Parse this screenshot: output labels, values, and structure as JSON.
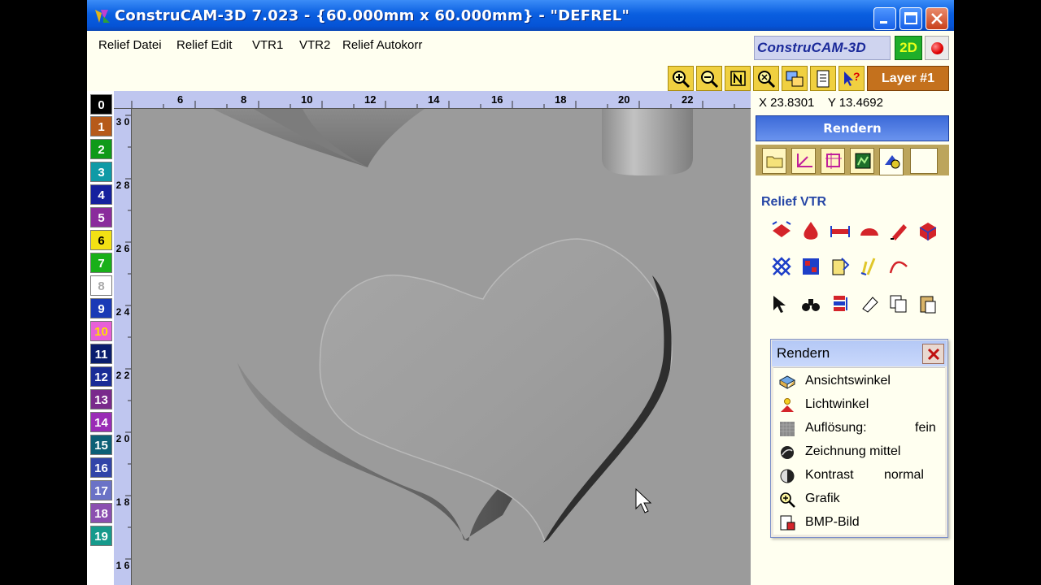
{
  "window": {
    "title": "ConstruCAM-3D 7.023 - {60.000mm x 60.000mm} - \"DEFREL\""
  },
  "menu": [
    {
      "label": "Relief Datei"
    },
    {
      "label": "Relief Edit"
    },
    {
      "label": "VTR1"
    },
    {
      "label": "VTR2"
    },
    {
      "label": "Relief Autokorr"
    }
  ],
  "brand": {
    "logo_text": "ConstruCAM-3D",
    "mode_label": "2D"
  },
  "toolbar": {
    "layer_label": "Layer #1",
    "icons": [
      "zoom-in-icon",
      "zoom-out-icon",
      "normal-view-icon",
      "zoom-fit-icon",
      "view-swap-icon",
      "document-icon",
      "help-pointer-icon"
    ]
  },
  "layers": [
    {
      "label": "0",
      "color": "#000000"
    },
    {
      "label": "1",
      "color": "#b65a1a"
    },
    {
      "label": "2",
      "color": "#0f9a19"
    },
    {
      "label": "3",
      "color": "#0f9aa6"
    },
    {
      "label": "4",
      "color": "#15219e"
    },
    {
      "label": "5",
      "color": "#8a2c9c"
    },
    {
      "label": "6",
      "color": "#f2e114"
    },
    {
      "label": "7",
      "color": "#19b019"
    },
    {
      "label": "8",
      "color": "#ffffff"
    },
    {
      "label": "9",
      "color": "#1a3ab6"
    },
    {
      "label": "10",
      "color": "#e85fd8"
    },
    {
      "label": "11",
      "color": "#0a1d6e"
    },
    {
      "label": "12",
      "color": "#1a2c96"
    },
    {
      "label": "13",
      "color": "#7a2a8c"
    },
    {
      "label": "14",
      "color": "#9a2cb6"
    },
    {
      "label": "15",
      "color": "#0d5f76"
    },
    {
      "label": "16",
      "color": "#3245a8"
    },
    {
      "label": "17",
      "color": "#6a72c6"
    },
    {
      "label": "18",
      "color": "#8b4fb0"
    },
    {
      "label": "19",
      "color": "#169a8c"
    }
  ],
  "ruler_top": [
    "6",
    "8",
    "10",
    "12",
    "14",
    "16",
    "18",
    "20",
    "22"
  ],
  "ruler_left": [
    "3 0",
    "2 8",
    "2 6",
    "2 4",
    "2 2",
    "2 0",
    "1 8",
    "1 6"
  ],
  "status": {
    "x_label": "X 23.8301",
    "y_label": "Y 13.4692"
  },
  "panel": {
    "title": "Rendern",
    "section": "Relief VTR",
    "tab_icons": [
      "folder-icon",
      "axis-icon",
      "frame-icon",
      "image-icon",
      "render-shapes-icon",
      "blank-tab"
    ],
    "tool_icons": [
      "relief-base-icon",
      "relief-drop-icon",
      "relief-bridge-icon",
      "relief-dome-icon",
      "relief-pen-icon",
      "relief-box-icon",
      "relief-grid-icon",
      "relief-tile-icon",
      "relief-note-icon",
      "relief-marker-icon",
      "relief-curve-icon",
      "select-arrow-icon",
      "binoculars-icon",
      "layers-icon",
      "eraser-icon",
      "copy-icon",
      "paste-icon"
    ]
  },
  "render_menu": {
    "title": "Rendern",
    "items": [
      {
        "label": "Ansichtswinkel",
        "value": "",
        "icon": "view-angle-icon"
      },
      {
        "label": "Lichtwinkel",
        "value": "",
        "icon": "light-angle-icon"
      },
      {
        "label": "Auflösung:",
        "value": "fein",
        "icon": "resolution-icon"
      },
      {
        "label": "Zeichnung mittel",
        "value": "",
        "icon": "drawing-icon"
      },
      {
        "label": "Kontrast",
        "value": "normal",
        "icon": "contrast-icon"
      },
      {
        "label": "Grafik",
        "value": "",
        "icon": "graphic-icon"
      },
      {
        "label": "BMP-Bild",
        "value": "",
        "icon": "bmp-icon"
      }
    ]
  },
  "colors": {
    "title_bar": "#0a5fe0",
    "canvas": "#9b9b9b",
    "ruler": "#bfc6ef",
    "tool_yellow": "#f0d040",
    "layer_orange": "#c4711d"
  }
}
